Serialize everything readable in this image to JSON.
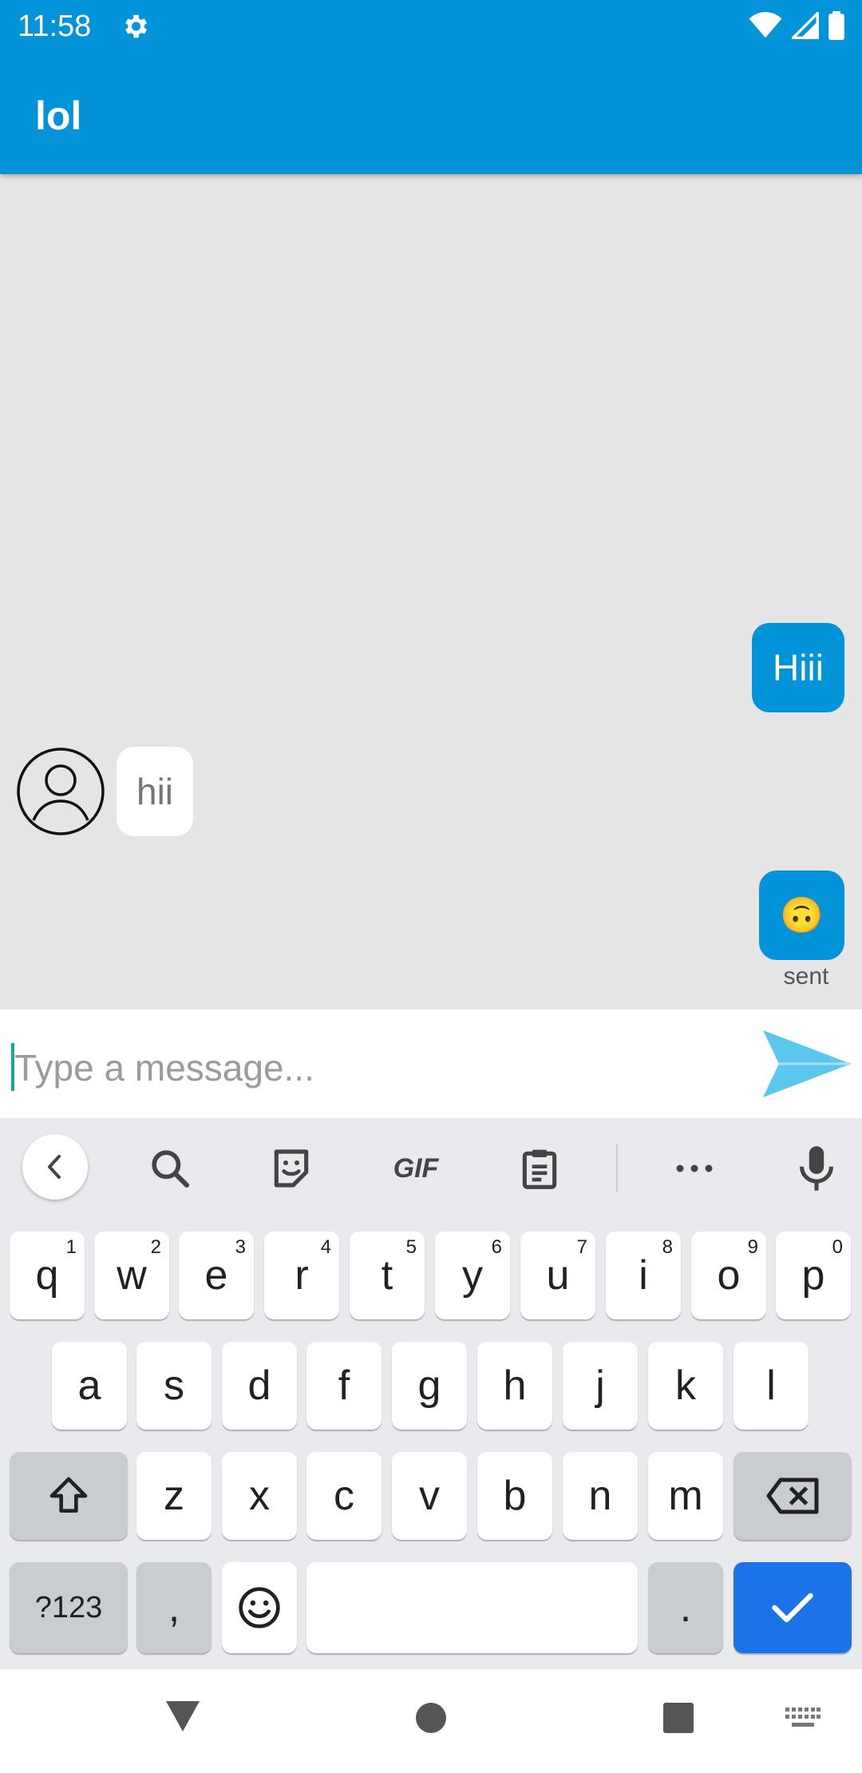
{
  "status_bar": {
    "time": "11:58"
  },
  "app_bar": {
    "title": "lol"
  },
  "messages": [
    {
      "direction": "outgoing",
      "text": "Hiii"
    },
    {
      "direction": "incoming",
      "text": "hii"
    },
    {
      "direction": "outgoing",
      "text": "🙃",
      "status": "sent"
    }
  ],
  "composer": {
    "placeholder": "Type a message..."
  },
  "keyboard": {
    "toolbar": [
      "back-icon",
      "search-icon",
      "sticker-icon",
      "GIF",
      "clipboard-icon",
      "more-icon",
      "mic-icon"
    ],
    "row1": [
      {
        "label": "q",
        "hint": "1"
      },
      {
        "label": "w",
        "hint": "2"
      },
      {
        "label": "e",
        "hint": "3"
      },
      {
        "label": "r",
        "hint": "4"
      },
      {
        "label": "t",
        "hint": "5"
      },
      {
        "label": "y",
        "hint": "6"
      },
      {
        "label": "u",
        "hint": "7"
      },
      {
        "label": "i",
        "hint": "8"
      },
      {
        "label": "o",
        "hint": "9"
      },
      {
        "label": "p",
        "hint": "0"
      }
    ],
    "row2": [
      "a",
      "s",
      "d",
      "f",
      "g",
      "h",
      "j",
      "k",
      "l"
    ],
    "row3": [
      "z",
      "x",
      "c",
      "v",
      "b",
      "n",
      "m"
    ],
    "row4": {
      "symbols": "?123",
      "comma": ",",
      "period": "."
    }
  },
  "colors": {
    "accent": "#0393d8",
    "enter_key": "#1a73e8"
  }
}
